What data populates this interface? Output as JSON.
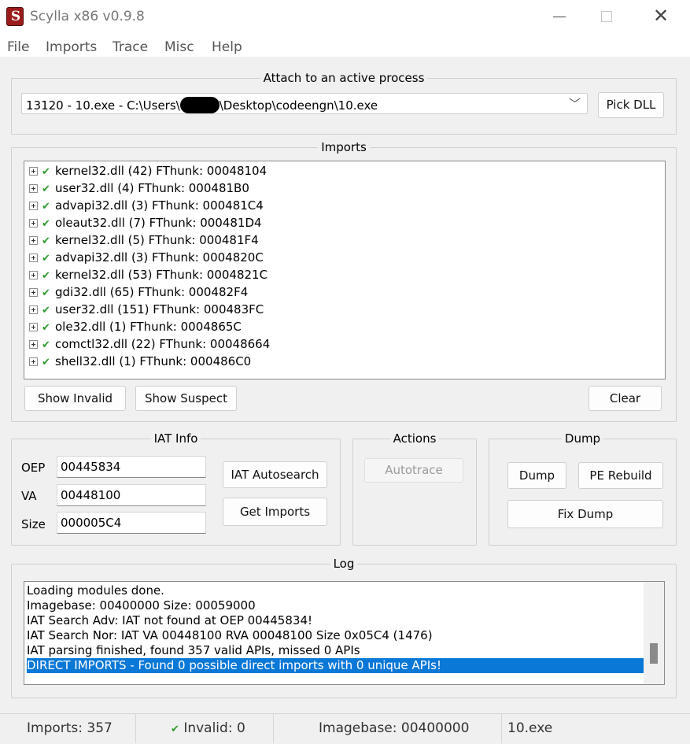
{
  "window": {
    "title": "Scylla x86 v0.9.8"
  },
  "menu": [
    "File",
    "Imports",
    "Trace",
    "Misc",
    "Help"
  ],
  "attach": {
    "title": "Attach to an active process",
    "process_prefix": "13120 - 10.exe - C:\\Users\\",
    "process_suffix": "\\Desktop\\codeengn\\10.exe",
    "pick_dll": "Pick DLL"
  },
  "imports": {
    "title": "Imports",
    "items": [
      "kernel32.dll (42) FThunk: 00048104",
      "user32.dll (4) FThunk: 000481B0",
      "advapi32.dll (3) FThunk: 000481C4",
      "oleaut32.dll (7) FThunk: 000481D4",
      "kernel32.dll (5) FThunk: 000481F4",
      "advapi32.dll (3) FThunk: 0004820C",
      "kernel32.dll (53) FThunk: 0004821C",
      "gdi32.dll (65) FThunk: 000482F4",
      "user32.dll (151) FThunk: 000483FC",
      "ole32.dll (1) FThunk: 0004865C",
      "comctl32.dll (22) FThunk: 00048664",
      "shell32.dll (1) FThunk: 000486C0"
    ],
    "show_invalid": "Show Invalid",
    "show_suspect": "Show Suspect",
    "clear": "Clear"
  },
  "iat": {
    "title": "IAT Info",
    "oep_label": "OEP",
    "oep": "00445834",
    "va_label": "VA",
    "va": "00448100",
    "size_label": "Size",
    "size": "000005C4",
    "autosearch": "IAT Autosearch",
    "get_imports": "Get Imports"
  },
  "actions": {
    "title": "Actions",
    "autotrace": "Autotrace"
  },
  "dump": {
    "title": "Dump",
    "dump": "Dump",
    "pe_rebuild": "PE Rebuild",
    "fix_dump": "Fix Dump"
  },
  "log": {
    "title": "Log",
    "lines": [
      "Loading modules done.",
      "Imagebase: 00400000 Size: 00059000",
      "IAT Search Adv: IAT not found at OEP 00445834!",
      "IAT Search Nor: IAT VA 00448100 RVA 00048100 Size 0x05C4 (1476)",
      "IAT parsing finished, found 357 valid APIs, missed 0 APIs",
      "DIRECT IMPORTS - Found 0 possible direct imports with 0 unique APIs!"
    ]
  },
  "status": {
    "imports": "Imports: 357",
    "invalid": "Invalid: 0",
    "imagebase": "Imagebase: 00400000",
    "module": "10.exe"
  },
  "colors": {
    "check": "#2e9a2e",
    "selection": "#0a78d7"
  }
}
